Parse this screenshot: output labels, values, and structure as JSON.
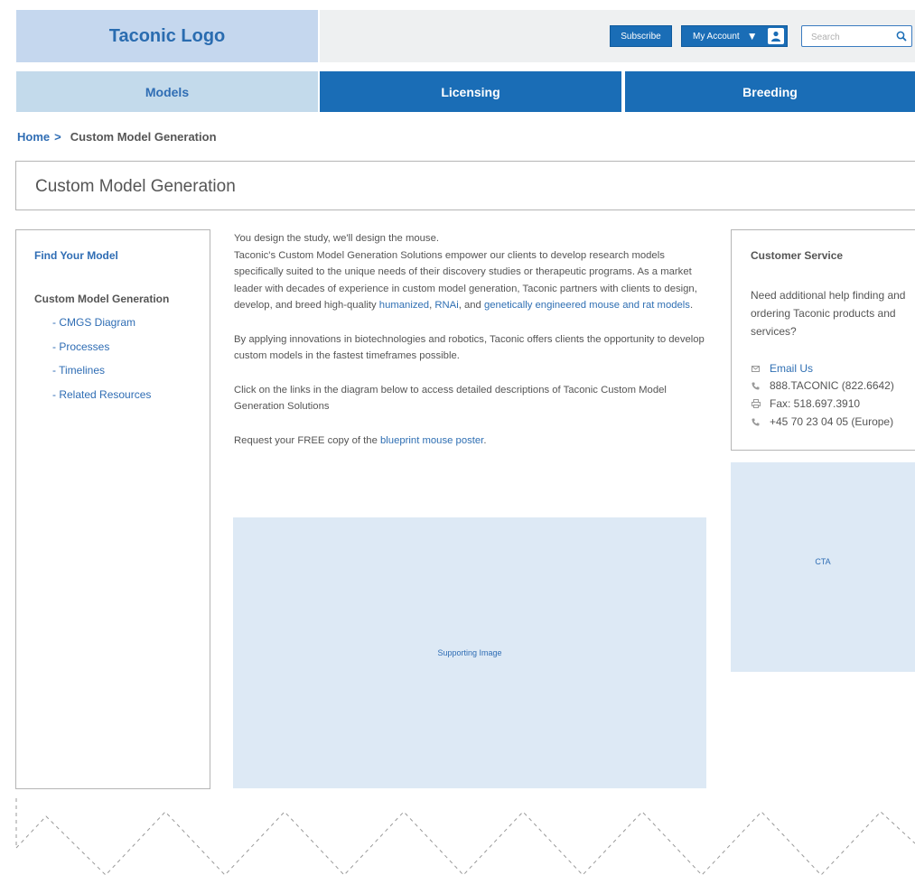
{
  "header": {
    "logo": "Taconic Logo",
    "subscribe": "Subscribe",
    "account": "My Account",
    "search_placeholder": "Search"
  },
  "nav": {
    "models": "Models",
    "licensing": "Licensing",
    "breeding": "Breeding"
  },
  "breadcrumb": {
    "home": "Home",
    "separator": ">",
    "current": "Custom Model Generation"
  },
  "page_title": "Custom Model Generation",
  "sidebar": {
    "find": "Find Your Model",
    "heading": "Custom Model Generation",
    "links": [
      "- CMGS Diagram",
      "- Processes",
      "- Timelines",
      "- Related Resources"
    ]
  },
  "main": {
    "tagline": "You design the study, we'll design the mouse.",
    "intro_before": "Taconic's Custom Model Generation Solutions empower our clients to develop research models specifically suited to the unique needs of their discovery studies or therapeutic programs. As a market leader with decades of experience in custom model generation, Taconic partners with clients to design, develop, and breed high-quality ",
    "link_humanized": "humanized",
    "comma": ", ",
    "link_rnai": "RNAi",
    "and": ", and ",
    "link_ge": "genetically engineered mouse and rat models",
    "period": ".",
    "para2": "By applying innovations in biotechnologies and robotics, Taconic offers clients the opportunity to develop custom models in the fastest timeframes possible.",
    "para3": "Click on the links in the diagram below to access detailed descriptions of Taconic Custom Model Generation Solutions",
    "request_before": "Request your FREE copy of the ",
    "link_poster": "blueprint mouse poster",
    "request_after": ".",
    "image_label": "Supporting Image"
  },
  "customer_service": {
    "heading": "Customer Service",
    "text": "Need additional help finding and ordering Taconic products and services?",
    "email": "Email Us",
    "phone": "888.TACONIC (822.6642)",
    "fax": "Fax: 518.697.3910",
    "europe": "+45 70 23 04 05 (Europe)"
  },
  "cta": "CTA",
  "colors": {
    "brand_blue": "#1a6db6",
    "light_blue": "#c5d7ee",
    "placeholder_fill": "#dde9f5"
  }
}
